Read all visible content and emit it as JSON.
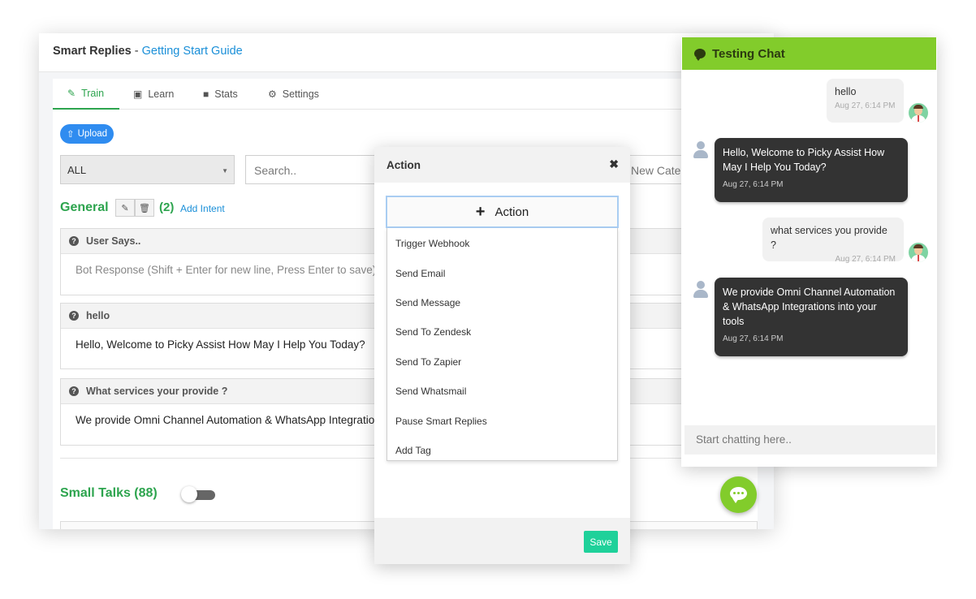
{
  "header": {
    "title": "Smart Replies",
    "separator": "-",
    "guide_link": "Getting Start Guide"
  },
  "tabs": [
    {
      "label": "Train",
      "icon": "edit-icon",
      "active": true
    },
    {
      "label": "Learn",
      "icon": "image-icon",
      "active": false
    },
    {
      "label": "Stats",
      "icon": "video-icon",
      "active": false
    },
    {
      "label": "Settings",
      "icon": "gear-icon",
      "active": false
    }
  ],
  "toolbar": {
    "upload_label": "Upload",
    "category_value": "ALL",
    "search_placeholder": "Search..",
    "new_category_placeholder": "New Catego"
  },
  "general": {
    "title": "General",
    "count": "(2)",
    "add_intent": "Add Intent"
  },
  "intents": [
    {
      "question": "User Says..",
      "answer": "Bot Response (Shift + Enter for new line, Press Enter to save)",
      "placeholder": true
    },
    {
      "question": "hello",
      "answer": "Hello, Welcome to Picky Assist How May I Help You Today?",
      "placeholder": false
    },
    {
      "question": "What services your provide ?",
      "answer": "We provide Omni Channel Automation & WhatsApp Integrations into your tools",
      "placeholder": false
    }
  ],
  "small_talks": {
    "title": "Small Talks (88)",
    "enabled": false
  },
  "modal": {
    "title": "Action",
    "close_icon": "✖",
    "action_button_label": "Action",
    "actions": [
      "Trigger Webhook",
      "Send Email",
      "Send Message",
      "Send To Zendesk",
      "Send To Zapier",
      "Send Whatsmail",
      "Pause Smart Replies",
      "Add Tag"
    ],
    "save_label": "Save"
  },
  "chat": {
    "title": "Testing Chat",
    "messages": [
      {
        "from": "user",
        "text": "hello",
        "time": "Aug 27, 6:14 PM"
      },
      {
        "from": "bot",
        "text": "Hello, Welcome to Picky Assist How May I Help You Today?",
        "time": "Aug 27, 6:14 PM"
      },
      {
        "from": "user",
        "text": "what services you provide ?",
        "time": "Aug 27, 6:14 PM"
      },
      {
        "from": "bot",
        "text": "We provide Omni Channel Automation & WhatsApp Integrations into your tools",
        "time": "Aug 27, 6:14 PM"
      }
    ],
    "input_placeholder": "Start chatting here.."
  },
  "colors": {
    "brand_green": "#2da44e",
    "chat_green": "#82cc2b",
    "link_blue": "#1a8fd8",
    "upload_blue": "#2f8cf0",
    "save_green": "#1fd19a"
  }
}
